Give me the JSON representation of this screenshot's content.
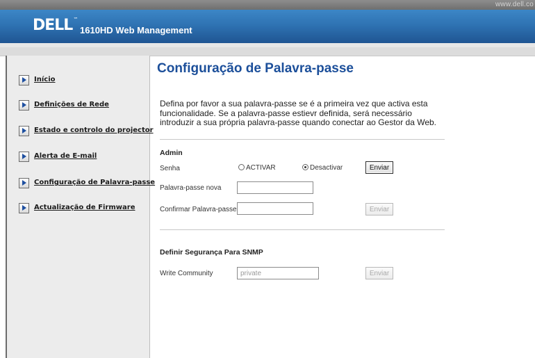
{
  "site_url": "www.dell.co",
  "header": {
    "logo": "DELL",
    "logo_tm": "™",
    "app_title": "1610HD Web Management"
  },
  "sidebar": {
    "items": [
      {
        "label": "Início",
        "icon": "arrow-right-icon"
      },
      {
        "label": "Definições de Rede",
        "icon": "arrow-right-icon"
      },
      {
        "label": "Estado e controlo do projector",
        "icon": "arrow-right-icon"
      },
      {
        "label": "Alerta de E-mail",
        "icon": "arrow-right-icon"
      },
      {
        "label": "Configuração de Palavra-passe",
        "icon": "arrow-right-icon"
      },
      {
        "label": "Actualização de Firmware",
        "icon": "arrow-right-icon"
      }
    ]
  },
  "main": {
    "title": "Configuração de Palavra-passe",
    "intro": "Defina por favor a sua palavra-passe se é a primeira vez que activa esta funcionalidade. Se a palavra-passe estievr definida, será necessário introduzir a sua própria palavra-passe quando conectar ao Gestor da Web.",
    "admin": {
      "heading": "Admin",
      "senha_label": "Senha",
      "radio_activar": "ACTIVAR",
      "radio_desactivar": "Desactivar",
      "selected": "Desactivar",
      "enviar_label": "Enviar",
      "new_password_label": "Palavra-passe nova",
      "new_password_value": "",
      "confirm_password_label": "Confirmar Palavra-passe",
      "confirm_password_value": "",
      "enviar_disabled_label": "Enviar"
    },
    "snmp": {
      "heading": "Definir Segurança Para SNMP",
      "write_community_label": "Write Community",
      "write_community_value": "private",
      "enviar_label": "Enviar"
    }
  },
  "colors": {
    "header_blue": "#2f73b3",
    "title_blue": "#1c4f9a",
    "sidebar_bg": "#ececec"
  }
}
